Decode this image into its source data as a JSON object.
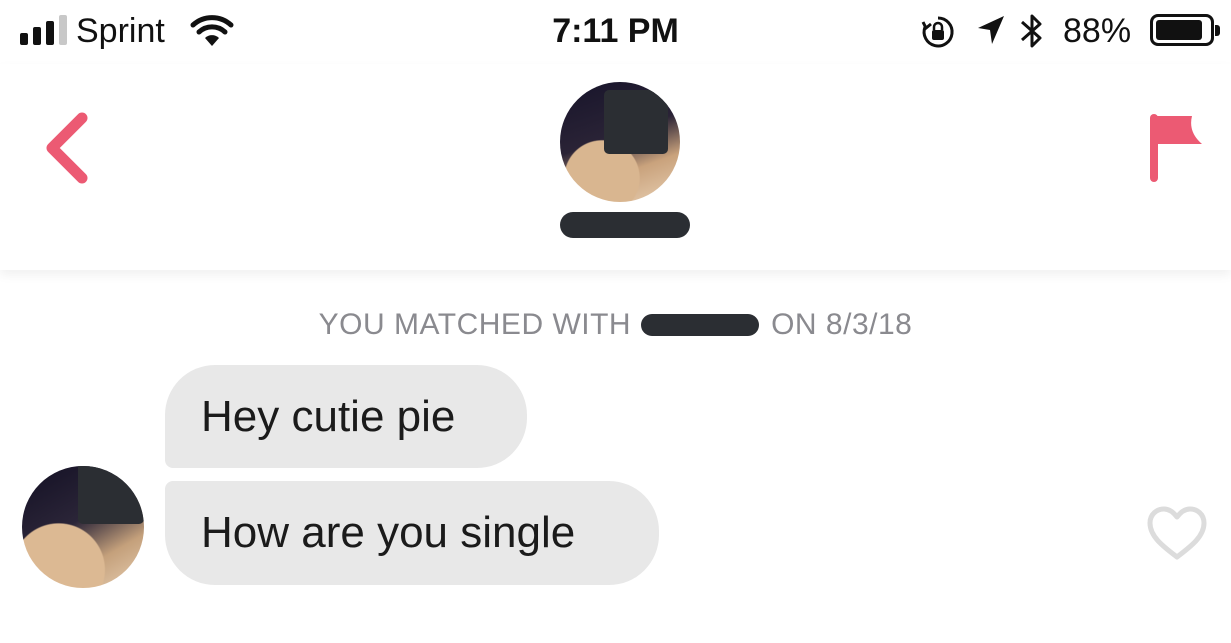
{
  "status_bar": {
    "carrier": "Sprint",
    "time": "7:11 PM",
    "battery_percent": "88%",
    "battery_level": 0.88,
    "signal_bars_filled": 3,
    "signal_bars_total": 4,
    "icons": [
      "signal-bars-icon",
      "wifi-icon",
      "rotation-lock-icon",
      "location-arrow-icon",
      "bluetooth-icon",
      "battery-icon"
    ]
  },
  "header": {
    "back_icon": "chevron-left-icon",
    "report_icon": "flag-icon",
    "accent_color": "#ec5a73"
  },
  "conversation": {
    "match_prefix": "YOU MATCHED WITH",
    "match_suffix": "ON 8/3/18",
    "messages": [
      {
        "text": "Hey cutie pie"
      },
      {
        "text": "How are you single"
      }
    ],
    "like_icon": "heart-outline-icon"
  }
}
